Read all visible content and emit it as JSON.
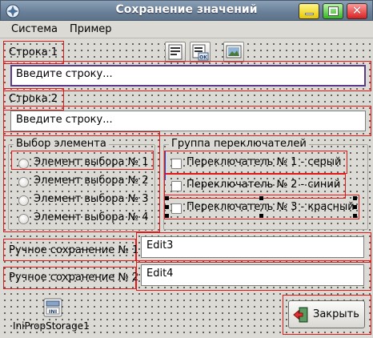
{
  "window": {
    "title": "Сохранение значений"
  },
  "menu": {
    "items": [
      "Система",
      "Пример"
    ]
  },
  "fields": {
    "line1_label": "Строка 1",
    "line1_placeholder": "Введите строку...",
    "line2_label": "Строка 2",
    "line2_placeholder": "Введите строку...",
    "manual1_label": "Ручное сохранение № 1",
    "manual1_value": "Edit3",
    "manual2_label": "Ручное сохранение № 2",
    "manual2_value": "Edit4"
  },
  "radio_group": {
    "caption": "Выбор элемента",
    "items": [
      "Элемент выбора № 1",
      "Элемент выбора № 2",
      "Элемент выбора № 3",
      "Элемент выбора № 4"
    ]
  },
  "check_group": {
    "caption": "Группа переключателей",
    "items": [
      "Переключатель № 1 - серый",
      "Переключатель № 2 - синий",
      "Переключатель № 3 - красный"
    ]
  },
  "component": {
    "label": "IniPropStorage1",
    "icon_text": "INI"
  },
  "buttons": {
    "close_label": "Закрыть"
  },
  "icons": [
    "app-icon",
    "form-list-icon",
    "form-ok-icon",
    "image-icon",
    "ini-storage-icon",
    "door-exit-icon"
  ]
}
